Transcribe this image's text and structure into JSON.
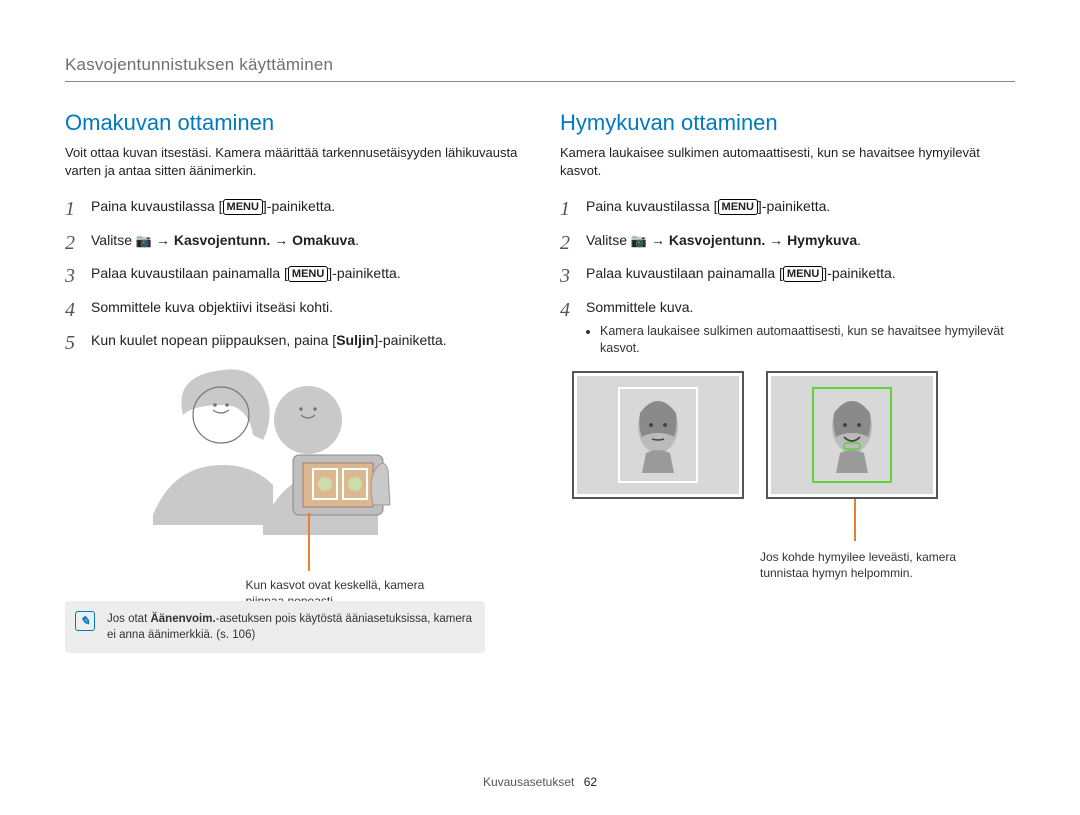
{
  "header": {
    "title": "Kasvojentunnistuksen käyttäminen"
  },
  "menu_label": "MENU",
  "left": {
    "title": "Omakuvan ottaminen",
    "intro": "Voit ottaa kuvan itsestäsi. Kamera määrittää tarkennusetäisyyden lähikuvausta varten ja antaa sitten äänimerkin.",
    "steps": {
      "s1a": "Paina kuvaustilassa [",
      "s1b": "]-painiketta.",
      "s2a": "Valitse ",
      "s2b": " → Kasvojentunn. → Omakuva",
      "s2c": ".",
      "s3a": "Palaa kuvaustilaan painamalla [",
      "s3b": "]-painiketta.",
      "s4": "Sommittele kuva objektiivi itseäsi kohti.",
      "s5a": "Kun kuulet nopean piippauksen, paina [",
      "s5b": "Suljin",
      "s5c": "]-painiketta."
    },
    "callout": "Kun kasvot ovat keskellä, kamera piippaa nopeasti.",
    "note_a": "Jos otat ",
    "note_b": "Äänenvoim.",
    "note_c": "-asetuksen pois käytöstä ääniasetuksissa, kamera ei anna äänimerkkiä. (s. 106)"
  },
  "right": {
    "title": "Hymykuvan ottaminen",
    "intro": "Kamera laukaisee sulkimen automaattisesti, kun se havaitsee hymyilevät kasvot.",
    "steps": {
      "s1a": "Paina kuvaustilassa [",
      "s1b": "]-painiketta.",
      "s2a": "Valitse ",
      "s2b": " → Kasvojentunn. → Hymykuva",
      "s2c": ".",
      "s3a": "Palaa kuvaustilaan painamalla [",
      "s3b": "]-painiketta.",
      "s4": "Sommittele kuva.",
      "s4_sub": "Kamera laukaisee sulkimen automaattisesti, kun se havaitsee hymyilevät kasvot."
    },
    "callout": "Jos kohde hymyilee leveästi, kamera tunnistaa hymyn helpommin."
  },
  "footer": {
    "section": "Kuvausasetukset",
    "page": "62"
  }
}
